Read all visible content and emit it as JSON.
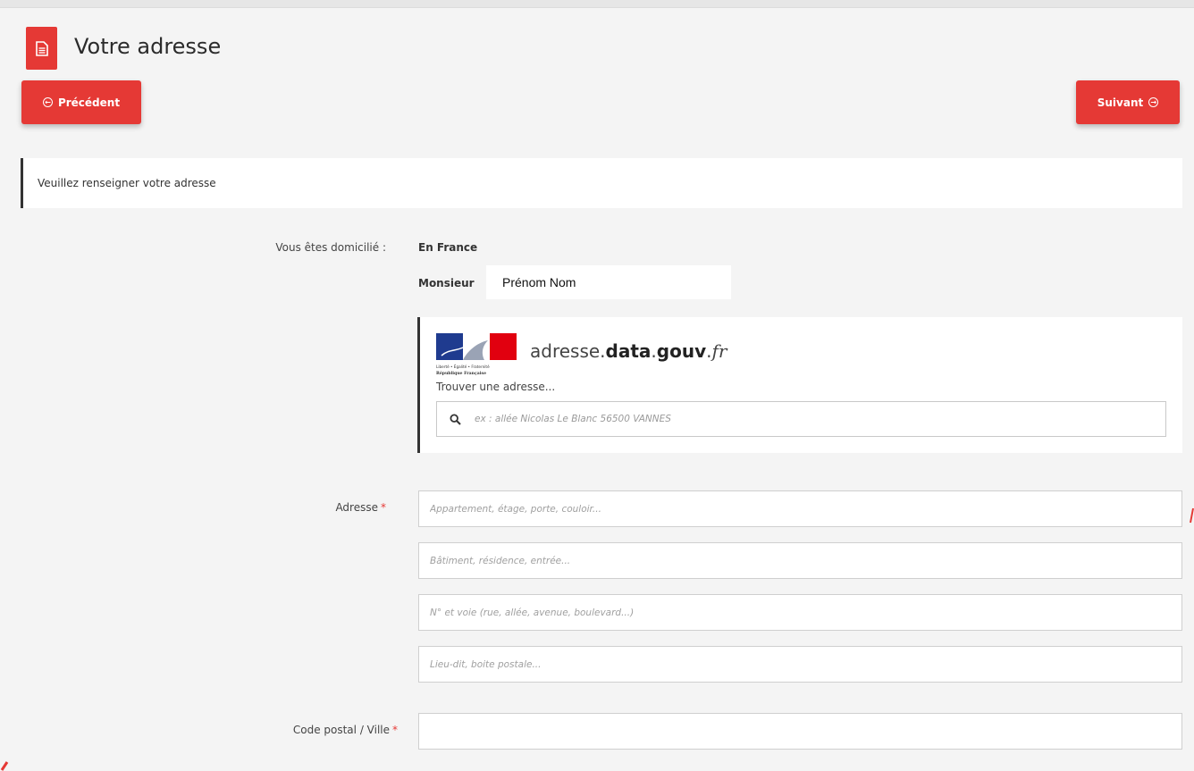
{
  "header": {
    "title": "Votre adresse",
    "icon": "document-icon"
  },
  "nav": {
    "prev_label": "Précédent",
    "next_label": "Suivant"
  },
  "info": {
    "message": "Veuillez renseigner votre adresse"
  },
  "residence": {
    "label": "Vous êtes domicilié :",
    "value": "En France"
  },
  "person": {
    "civility": "Monsieur",
    "name": "Prénom Nom"
  },
  "ban": {
    "logo_prefix": "adresse.",
    "logo_bold": "data",
    "logo_mid": ".",
    "logo_bold2": "gouv",
    "logo_dot": ".",
    "logo_suffix": "fr",
    "prompt": "Trouver une adresse...",
    "search_placeholder": "ex : allée Nicolas Le Blanc 56500 VANNES",
    "marianne_motto": "Liberté • Égalité • Fraternité",
    "marianne_name": "République Française"
  },
  "address": {
    "label": "Adresse",
    "line1_placeholder": "Appartement, étage, porte, couloir...",
    "line2_placeholder": "Bâtiment, résidence, entrée...",
    "line3_placeholder": "N° et voie (rue, allée, avenue, boulevard...)",
    "line4_placeholder": "Lieu-dit, boite postale..."
  },
  "postal": {
    "label": "Code postal / Ville"
  },
  "required_mark": "*",
  "colors": {
    "accent": "#e53935",
    "background": "#f4f4f4",
    "border_dark": "#333333"
  }
}
